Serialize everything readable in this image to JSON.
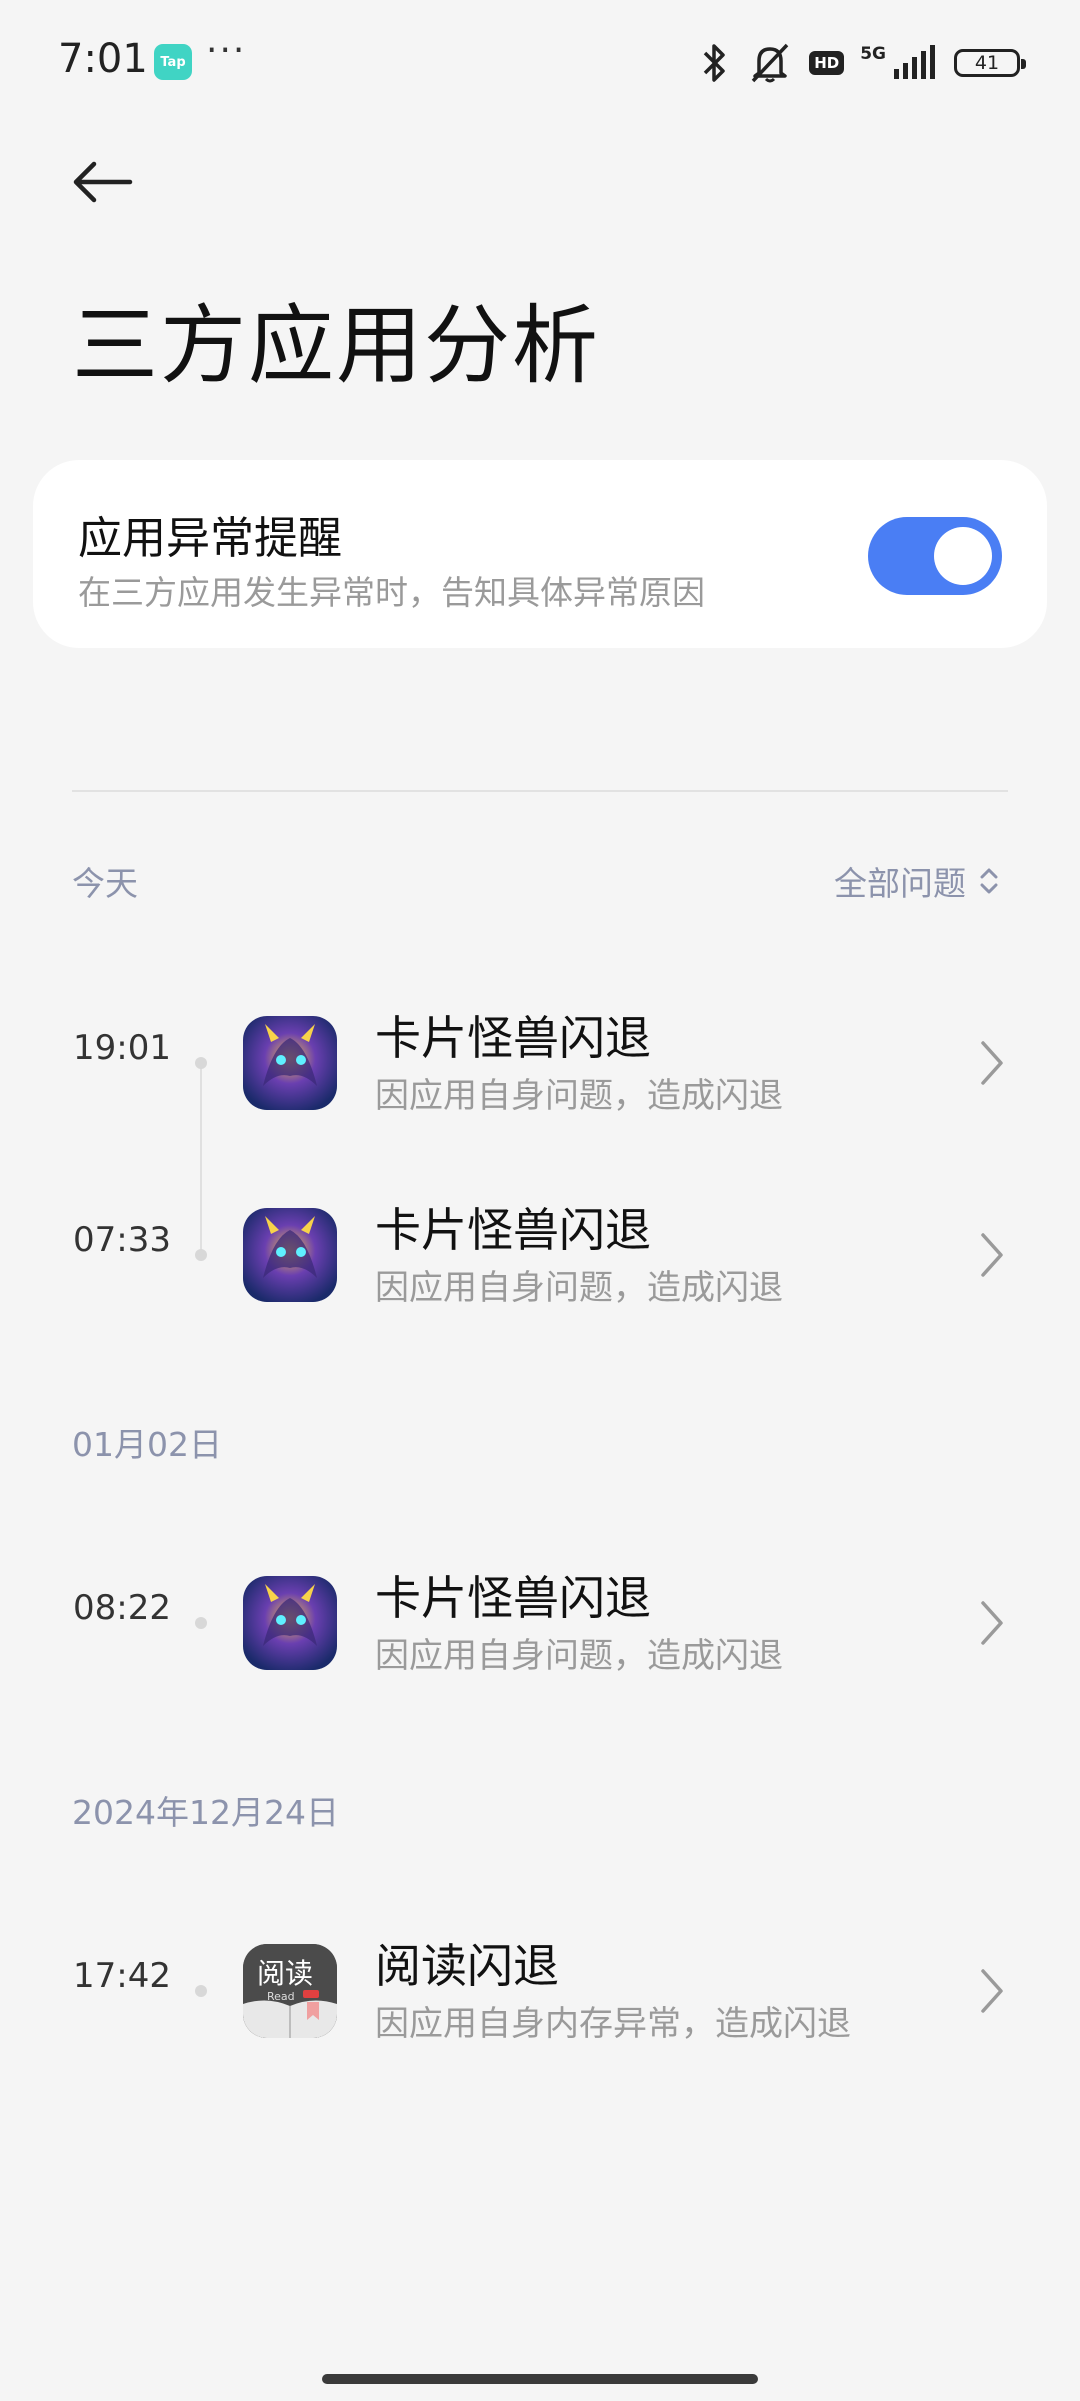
{
  "status_bar": {
    "time": "7:01",
    "tap_label": "Tap",
    "more": "···",
    "hd": "HD",
    "network": "5G",
    "battery": "41",
    "icons": [
      "bluetooth-icon",
      "mute-icon",
      "hd-icon",
      "signal-icon",
      "battery-icon"
    ]
  },
  "header": {
    "title": "三方应用分析"
  },
  "alert_card": {
    "title": "应用异常提醒",
    "subtitle": "在三方应用发生异常时，告知具体异常原因",
    "toggle_on": true
  },
  "filter": {
    "label": "全部问题"
  },
  "sections": [
    {
      "date": "今天",
      "items": [
        {
          "time": "19:01",
          "title": "卡片怪兽闪退",
          "detail": "因应用自身问题，造成闪退",
          "icon": "card-monster-app-icon"
        },
        {
          "time": "07:33",
          "title": "卡片怪兽闪退",
          "detail": "因应用自身问题，造成闪退",
          "icon": "card-monster-app-icon"
        }
      ]
    },
    {
      "date": "01月02日",
      "items": [
        {
          "time": "08:22",
          "title": "卡片怪兽闪退",
          "detail": "因应用自身问题，造成闪退",
          "icon": "card-monster-app-icon"
        }
      ]
    },
    {
      "date": "2024年12月24日",
      "items": [
        {
          "time": "17:42",
          "title": "阅读闪退",
          "detail": "因应用自身内存异常，造成闪退",
          "icon": "reading-app-icon",
          "icon_text": "阅读",
          "icon_subtext": "Read"
        }
      ]
    }
  ],
  "colors": {
    "accent": "#4a7ef4",
    "background": "#f5f5f5",
    "muted_blue": "#8c93ac"
  }
}
